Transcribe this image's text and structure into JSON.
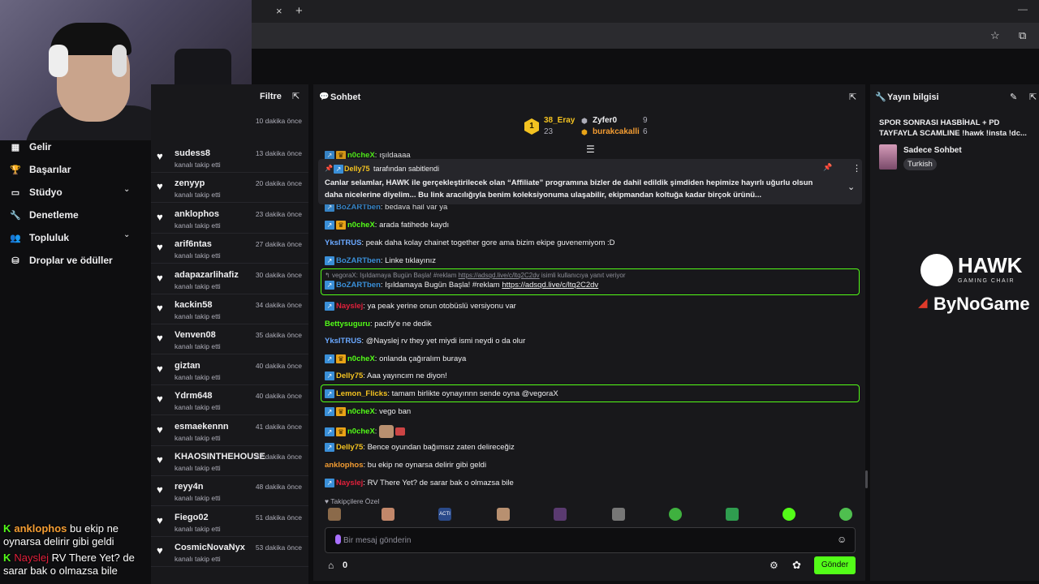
{
  "browser": {
    "close_glyph": "×",
    "plus_glyph": "+",
    "min_glyph": "—",
    "star_glyph": "☆",
    "ext_glyph": "⧉"
  },
  "nav": {
    "items": [
      {
        "label": "Gelir",
        "icon": "revenue-icon",
        "glyph": "▦"
      },
      {
        "label": "Başarılar",
        "icon": "trophy-icon",
        "glyph": "🏆"
      },
      {
        "label": "Stüdyo",
        "icon": "studio-icon",
        "glyph": "▭",
        "chevron": "⌄"
      },
      {
        "label": "Denetleme",
        "icon": "wrench-icon",
        "glyph": "🔧"
      },
      {
        "label": "Topluluk",
        "icon": "community-icon",
        "glyph": "👥",
        "chevron": "⌄"
      },
      {
        "label": "Droplar ve ödüller",
        "icon": "drops-icon",
        "glyph": "⛁"
      }
    ]
  },
  "overlay_chat": [
    {
      "k": "K",
      "user": "anklophos",
      "user_color": "#f39c32",
      "text": "bu ekip ne oynarsa delirir gibi geldi"
    },
    {
      "k": "K",
      "user": "Nayslej",
      "user_color": "#e0203b",
      "text": "RV There Yet? de sarar bak o olmazsa bile"
    }
  ],
  "follows": {
    "title": "Filtre",
    "expand_glyph": "⇱",
    "first_time": "10 dakika önce",
    "sub": "kanalı takip etti",
    "heart": "♥",
    "rows": [
      {
        "name": "sudess8",
        "time": "13 dakika önce"
      },
      {
        "name": "zenyyp",
        "time": "20 dakika önce"
      },
      {
        "name": "anklophos",
        "time": "23 dakika önce"
      },
      {
        "name": "arif6ntas",
        "time": "27 dakika önce"
      },
      {
        "name": "adapazarlihafiz",
        "time": "30 dakika önce"
      },
      {
        "name": "kackin58",
        "time": "34 dakika önce"
      },
      {
        "name": "Venven08",
        "time": "35 dakika önce"
      },
      {
        "name": "giztan",
        "time": "40 dakika önce"
      },
      {
        "name": "Ydrm648",
        "time": "40 dakika önce"
      },
      {
        "name": "esmaekennn",
        "time": "41 dakika önce"
      },
      {
        "name": "KHAOSINTHEHOUSE",
        "time": "47 dakika önce"
      },
      {
        "name": "reyy4n",
        "time": "48 dakika önce"
      },
      {
        "name": "Fiego02",
        "time": "51 dakika önce"
      },
      {
        "name": "CosmicNovaNyx",
        "time": "53 dakika önce"
      }
    ]
  },
  "chat": {
    "title": "Sohbet",
    "chat_icon": "💬",
    "expand_glyph": "⇱",
    "leaderboard": [
      {
        "rank": "1",
        "name": "38_Eray",
        "value": "23",
        "color": "#f3c221"
      },
      {
        "name": "Zyfer0",
        "value": "9",
        "color": "#efeff1"
      },
      {
        "name": "burakcakalli",
        "value": "6",
        "color": "#f39c32"
      }
    ],
    "menu_glyph": "☰",
    "pinned": {
      "by_user": "Delly75",
      "by_text": "tarafından sabitlendi",
      "text_line1": "Canlar selamlar, HAWK ile gerçekleştirilecek olan “Affiliate” programına bizler de dahil edildik şimdiden hepimize hayırlı uğurlu olsun",
      "text_line2": "daha nicelerine diyelim... Bu link aracılığıyla benim koleksiyonuma ulaşabilir, ekipmandan koltuğa kadar birçok ürünü...",
      "pin_glyph": "📌",
      "more_glyph": "⋮",
      "chevron": "⌄"
    },
    "messages": [
      {
        "user": "n0cheX",
        "user_color": "#53fc18",
        "text": "ışıldaaaa",
        "badges": [
          "sq",
          "crown"
        ],
        "cut": true
      },
      {
        "user": "BoZARTben",
        "user_color": "#3a8fd8",
        "text": "bedava hail var ya",
        "badges": [
          "sq"
        ],
        "cut": true
      },
      {
        "user": "n0cheX",
        "user_color": "#53fc18",
        "text": "arada fatihede kaydı",
        "badges": [
          "sq",
          "crown"
        ]
      },
      {
        "user": "YksITRUS",
        "user_color": "#6aa8ff",
        "text": "peak daha kolay chainet together gore ama bizim ekipe guvenemiyom :D",
        "badges": []
      },
      {
        "user": "BoZARTben",
        "user_color": "#3a8fd8",
        "text": "Linke tıklayınız",
        "badges": [
          "sq"
        ]
      },
      {
        "reply_to": "vegoraX: Işıldamaya Bugün Başla! #reklam",
        "reply_link": "https://adsqd.live/c/ltq2C2dv",
        "reply_suffix": "isimli kullanıcıya yanıt veriyor",
        "user": "BoZARTben",
        "user_color": "#3a8fd8",
        "text": "Işıldamaya Bugün Başla! #reklam",
        "link": "https://adsqd.live/c/ltq2C2dv",
        "badges": [
          "sq"
        ]
      },
      {
        "user": "Nayslej",
        "user_color": "#e0203b",
        "text": "ya peak yerine onun otobüslü versiyonu var",
        "badges": [
          "sq"
        ]
      },
      {
        "user": "Bettysuguru",
        "user_color": "#53fc18",
        "text": "pacify'e ne dedik",
        "badges": []
      },
      {
        "user": "YksITRUS",
        "user_color": "#6aa8ff",
        "text": "@Nayslej rv they yet miydi ismi neydi o da olur",
        "badges": []
      },
      {
        "user": "n0cheX",
        "user_color": "#53fc18",
        "text": "onlanda çağıralım buraya",
        "badges": [
          "sq",
          "crown"
        ]
      },
      {
        "user": "Delly75",
        "user_color": "#f3c221",
        "text": "Aaa yayıncım ne diyon!",
        "badges": [
          "sq"
        ]
      },
      {
        "user": "Lemon_Flicks",
        "user_color": "#f3c221",
        "text": "tamam birlikte oynayınnn sende oyna @vegoraX",
        "badges": [
          "sq"
        ],
        "hl": true
      },
      {
        "user": "n0cheX",
        "user_color": "#53fc18",
        "text": "vego ban",
        "badges": [
          "sq",
          "crown"
        ]
      },
      {
        "user": "n0cheX",
        "user_color": "#53fc18",
        "text": "",
        "badges": [
          "sq",
          "crown"
        ],
        "emote": true
      },
      {
        "user": "Delly75",
        "user_color": "#f3c221",
        "text": "Bence oyundan bağımsız zaten delireceğiz",
        "badges": [
          "sq"
        ]
      },
      {
        "user": "anklophos",
        "user_color": "#f39c32",
        "text": "bu ekip ne oynarsa delirir gibi geldi",
        "badges": []
      },
      {
        "user": "Nayslej",
        "user_color": "#e0203b",
        "text": "RV There Yet? de sarar bak o olmazsa bile",
        "badges": [
          "sq"
        ]
      }
    ],
    "followers_only": "Takipçilere Özel",
    "emote_colors": [
      "#8b6a4a",
      "#c2876a",
      "#2a4a8a",
      "#b89070",
      "#5a3a70",
      "#777777",
      "#3fb13f",
      "#2f9d4f",
      "#53fc18",
      "#4fbf4f"
    ],
    "emote_label": "ACTI",
    "input_placeholder": "Bir mesaj gönderin",
    "points": "0",
    "send_label": "Gönder",
    "settings_glyph": "⚙",
    "emoji_glyph": "☺"
  },
  "info": {
    "title": "Yayın bilgisi",
    "stream_title": "SPOR SONRASI HASBİHAL + PD TAYFAYLA SCAMLINE !hawk !insta !dc...",
    "category": "Sadece Sohbet",
    "tag": "Turkish",
    "edit_glyph": "✎",
    "expand_glyph": "⇱",
    "brand1": "HAWK",
    "brand1_sub": "GAMING CHAIR",
    "brand2": "ByNoGame"
  }
}
